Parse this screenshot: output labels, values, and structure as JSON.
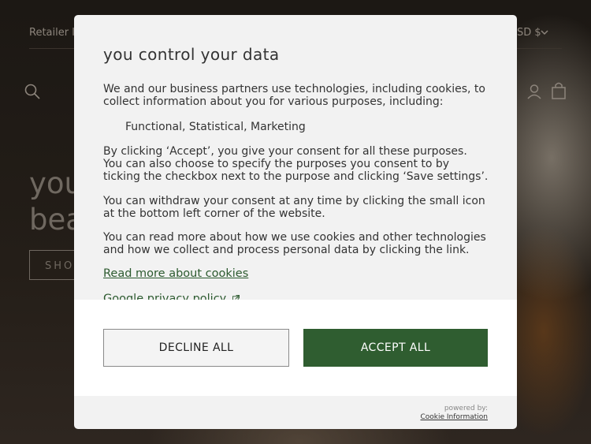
{
  "background": {
    "retailer_label": "Retailer lo",
    "currency_label": "SD $",
    "hero_line1": "you",
    "hero_line2": "bea",
    "shop_label": "SHO"
  },
  "modal": {
    "title": "you control your data",
    "intro": "We and our business partners use technologies, including cookies, to collect information about you for various purposes, including:",
    "purposes": "Functional, Statistical, Marketing",
    "consent_text": "By clicking ‘Accept’, you give your consent for all these purposes. You can also choose to specify the purposes you consent to by ticking the checkbox next to the purpose and clicking ‘Save settings’.",
    "withdraw_text": "You can withdraw your consent at any time by clicking the small icon at the bottom left corner of the website.",
    "read_more_text": "You can read more about how we use cookies and other technologies and how we collect and process personal data by clicking the link.",
    "read_more_link": "Read more about cookies",
    "privacy_link": "Google privacy policy",
    "decline_label": "DECLINE ALL",
    "accept_label": "ACCEPT ALL",
    "powered_by": "powered by:",
    "powered_by_name": "Cookie Information"
  },
  "colors": {
    "accent": "#2f5d30",
    "link": "#2c5a2f"
  },
  "icons": [
    "search-icon",
    "user-icon",
    "cart-icon",
    "chevron-down-icon",
    "external-link-icon"
  ]
}
